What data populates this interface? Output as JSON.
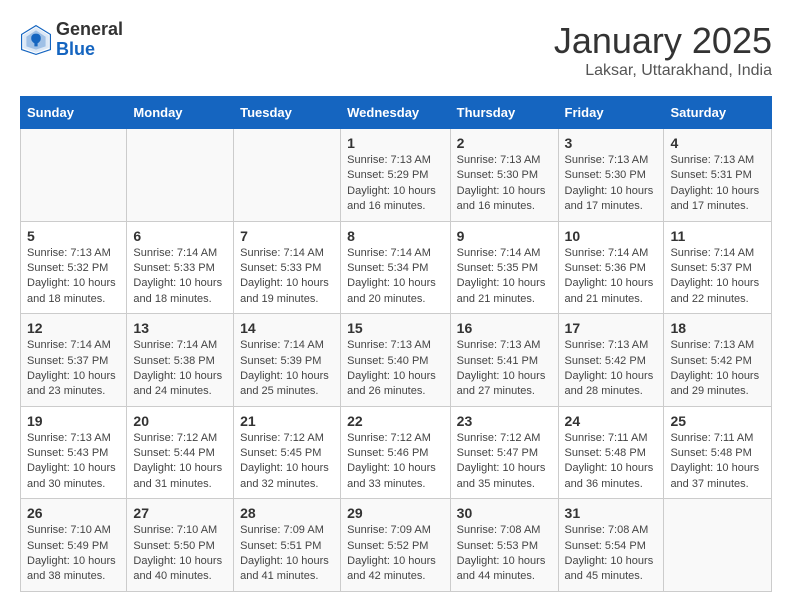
{
  "logo": {
    "general": "General",
    "blue": "Blue"
  },
  "header": {
    "title": "January 2025",
    "location": "Laksar, Uttarakhand, India"
  },
  "weekdays": [
    "Sunday",
    "Monday",
    "Tuesday",
    "Wednesday",
    "Thursday",
    "Friday",
    "Saturday"
  ],
  "weeks": [
    [
      {
        "day": "",
        "info": ""
      },
      {
        "day": "",
        "info": ""
      },
      {
        "day": "",
        "info": ""
      },
      {
        "day": "1",
        "info": "Sunrise: 7:13 AM\nSunset: 5:29 PM\nDaylight: 10 hours\nand 16 minutes."
      },
      {
        "day": "2",
        "info": "Sunrise: 7:13 AM\nSunset: 5:30 PM\nDaylight: 10 hours\nand 16 minutes."
      },
      {
        "day": "3",
        "info": "Sunrise: 7:13 AM\nSunset: 5:30 PM\nDaylight: 10 hours\nand 17 minutes."
      },
      {
        "day": "4",
        "info": "Sunrise: 7:13 AM\nSunset: 5:31 PM\nDaylight: 10 hours\nand 17 minutes."
      }
    ],
    [
      {
        "day": "5",
        "info": "Sunrise: 7:13 AM\nSunset: 5:32 PM\nDaylight: 10 hours\nand 18 minutes."
      },
      {
        "day": "6",
        "info": "Sunrise: 7:14 AM\nSunset: 5:33 PM\nDaylight: 10 hours\nand 18 minutes."
      },
      {
        "day": "7",
        "info": "Sunrise: 7:14 AM\nSunset: 5:33 PM\nDaylight: 10 hours\nand 19 minutes."
      },
      {
        "day": "8",
        "info": "Sunrise: 7:14 AM\nSunset: 5:34 PM\nDaylight: 10 hours\nand 20 minutes."
      },
      {
        "day": "9",
        "info": "Sunrise: 7:14 AM\nSunset: 5:35 PM\nDaylight: 10 hours\nand 21 minutes."
      },
      {
        "day": "10",
        "info": "Sunrise: 7:14 AM\nSunset: 5:36 PM\nDaylight: 10 hours\nand 21 minutes."
      },
      {
        "day": "11",
        "info": "Sunrise: 7:14 AM\nSunset: 5:37 PM\nDaylight: 10 hours\nand 22 minutes."
      }
    ],
    [
      {
        "day": "12",
        "info": "Sunrise: 7:14 AM\nSunset: 5:37 PM\nDaylight: 10 hours\nand 23 minutes."
      },
      {
        "day": "13",
        "info": "Sunrise: 7:14 AM\nSunset: 5:38 PM\nDaylight: 10 hours\nand 24 minutes."
      },
      {
        "day": "14",
        "info": "Sunrise: 7:14 AM\nSunset: 5:39 PM\nDaylight: 10 hours\nand 25 minutes."
      },
      {
        "day": "15",
        "info": "Sunrise: 7:13 AM\nSunset: 5:40 PM\nDaylight: 10 hours\nand 26 minutes."
      },
      {
        "day": "16",
        "info": "Sunrise: 7:13 AM\nSunset: 5:41 PM\nDaylight: 10 hours\nand 27 minutes."
      },
      {
        "day": "17",
        "info": "Sunrise: 7:13 AM\nSunset: 5:42 PM\nDaylight: 10 hours\nand 28 minutes."
      },
      {
        "day": "18",
        "info": "Sunrise: 7:13 AM\nSunset: 5:42 PM\nDaylight: 10 hours\nand 29 minutes."
      }
    ],
    [
      {
        "day": "19",
        "info": "Sunrise: 7:13 AM\nSunset: 5:43 PM\nDaylight: 10 hours\nand 30 minutes."
      },
      {
        "day": "20",
        "info": "Sunrise: 7:12 AM\nSunset: 5:44 PM\nDaylight: 10 hours\nand 31 minutes."
      },
      {
        "day": "21",
        "info": "Sunrise: 7:12 AM\nSunset: 5:45 PM\nDaylight: 10 hours\nand 32 minutes."
      },
      {
        "day": "22",
        "info": "Sunrise: 7:12 AM\nSunset: 5:46 PM\nDaylight: 10 hours\nand 33 minutes."
      },
      {
        "day": "23",
        "info": "Sunrise: 7:12 AM\nSunset: 5:47 PM\nDaylight: 10 hours\nand 35 minutes."
      },
      {
        "day": "24",
        "info": "Sunrise: 7:11 AM\nSunset: 5:48 PM\nDaylight: 10 hours\nand 36 minutes."
      },
      {
        "day": "25",
        "info": "Sunrise: 7:11 AM\nSunset: 5:48 PM\nDaylight: 10 hours\nand 37 minutes."
      }
    ],
    [
      {
        "day": "26",
        "info": "Sunrise: 7:10 AM\nSunset: 5:49 PM\nDaylight: 10 hours\nand 38 minutes."
      },
      {
        "day": "27",
        "info": "Sunrise: 7:10 AM\nSunset: 5:50 PM\nDaylight: 10 hours\nand 40 minutes."
      },
      {
        "day": "28",
        "info": "Sunrise: 7:09 AM\nSunset: 5:51 PM\nDaylight: 10 hours\nand 41 minutes."
      },
      {
        "day": "29",
        "info": "Sunrise: 7:09 AM\nSunset: 5:52 PM\nDaylight: 10 hours\nand 42 minutes."
      },
      {
        "day": "30",
        "info": "Sunrise: 7:08 AM\nSunset: 5:53 PM\nDaylight: 10 hours\nand 44 minutes."
      },
      {
        "day": "31",
        "info": "Sunrise: 7:08 AM\nSunset: 5:54 PM\nDaylight: 10 hours\nand 45 minutes."
      },
      {
        "day": "",
        "info": ""
      }
    ]
  ]
}
